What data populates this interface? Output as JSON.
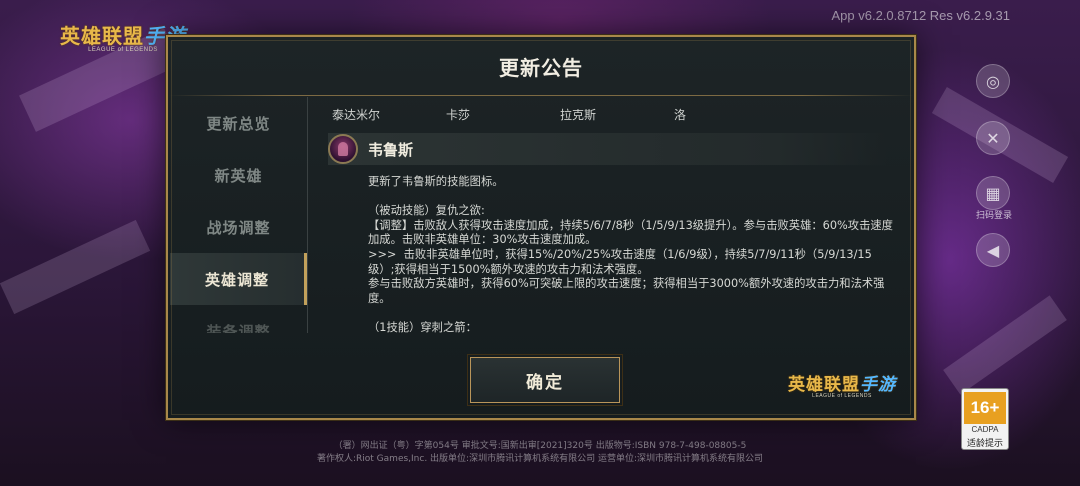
{
  "app": {
    "version": "App v6.2.0.8712 Res v6.2.9.31"
  },
  "logo": {
    "cn_main": "英雄联盟",
    "cn_script": "手游",
    "en": "LEAGUE of LEGENDS"
  },
  "side": {
    "scan_login_label": "扫码登录"
  },
  "age_rating": {
    "age": "16+",
    "org": "CADPA",
    "tip": "适龄提示"
  },
  "footer": {
    "line1": "（署）网出证（粤）字第054号  审批文号:国新出审[2021]320号  出版物号:ISBN 978-7-498-08805-5",
    "line2": "著作权人:Riot Games,Inc.  出版单位:深圳市腾讯计算机系统有限公司  运营单位:深圳市腾讯计算机系统有限公司"
  },
  "dialog": {
    "title": "更新公告",
    "confirm_label": "确定",
    "nav": [
      {
        "label": "更新总览"
      },
      {
        "label": "新英雄"
      },
      {
        "label": "战场调整"
      },
      {
        "label": "英雄调整"
      },
      {
        "label": "装备调整"
      }
    ],
    "champion_tabs": [
      {
        "label": "泰达米尔"
      },
      {
        "label": "卡莎"
      },
      {
        "label": "拉克斯"
      },
      {
        "label": "洛"
      }
    ],
    "hero": {
      "name": "韦鲁斯",
      "notes": "更新了韦鲁斯的技能图标。\n\n（被动技能）复仇之欲:\n【调整】击败敌人获得攻击速度加成，持续5/6/7/8秒（1/5/9/13级提升）。参与击败英雄：60%攻击速度加成。击败非英雄单位：30%攻击速度加成。\n>>>  击败非英雄单位时，获得15%/20%/25%攻击速度（1/6/9级），持续5/7/9/11秒（5/9/13/15级）;获得相当于1500%额外攻速的攻击力和法术强度。\n参与击败敌方英雄时，获得60%可突破上限的攻击速度；获得相当于3000%额外攻速的攻击力和法术强度。\n\n（1技能）穿刺之箭："
    }
  }
}
